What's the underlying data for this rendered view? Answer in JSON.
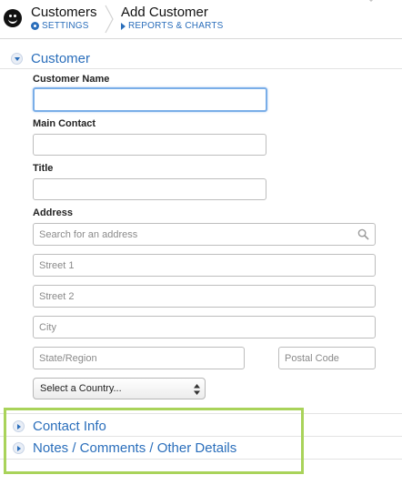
{
  "header": {
    "crumb1": {
      "title": "Customers",
      "link": "SETTINGS"
    },
    "crumb2": {
      "title": "Add Customer",
      "link": "REPORTS & CHARTS"
    }
  },
  "sections": {
    "customer": {
      "title": "Customer"
    },
    "contact_info": {
      "title": "Contact Info"
    },
    "notes": {
      "title": "Notes / Comments / Other Details"
    }
  },
  "form": {
    "customer_name": {
      "label": "Customer Name",
      "value": ""
    },
    "main_contact": {
      "label": "Main Contact",
      "value": ""
    },
    "title": {
      "label": "Title",
      "value": ""
    },
    "address": {
      "label": "Address",
      "search_placeholder": "Search for an address",
      "street1_placeholder": "Street 1",
      "street2_placeholder": "Street 2",
      "city_placeholder": "City",
      "state_placeholder": "State/Region",
      "postal_placeholder": "Postal Code"
    },
    "country": {
      "selected": "Select a Country..."
    }
  },
  "colors": {
    "accent": "#2a6ebb",
    "highlight": "#a9d35a",
    "focus": "#7aaee8"
  }
}
